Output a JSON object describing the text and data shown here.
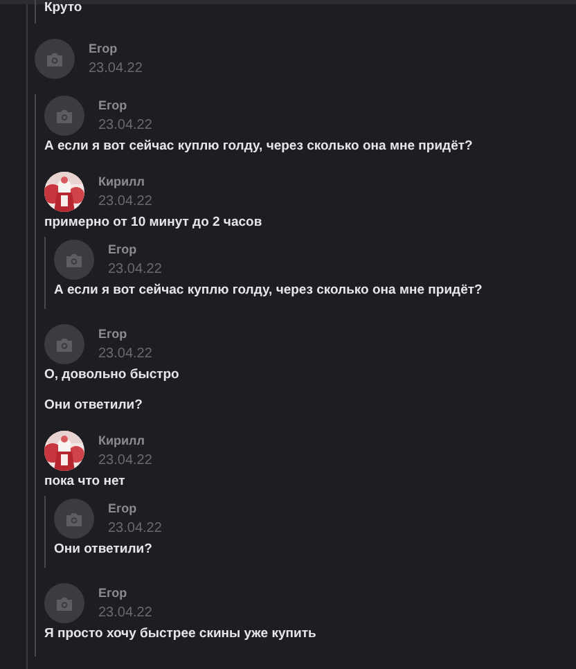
{
  "thread": [
    {
      "kind": "quote",
      "items": [
        {
          "kind": "text",
          "text": "Круто"
        }
      ]
    },
    {
      "kind": "message",
      "author": "Егор",
      "avatar": {
        "kind": "camera"
      },
      "date": "23.04.22"
    },
    {
      "kind": "quote",
      "items": [
        {
          "kind": "message",
          "author": "Егор",
          "avatar": {
            "kind": "camera"
          },
          "date": "23.04.22",
          "texts": [
            "А если я вот сейчас куплю голду, через сколько она мне придёт?"
          ]
        },
        {
          "kind": "message",
          "author": "Кирилл",
          "avatar": {
            "kind": "picture"
          },
          "date": "23.04.22",
          "texts": [
            "примерно от 10 минут до 2 часов"
          ]
        },
        {
          "kind": "quote",
          "items": [
            {
              "kind": "message",
              "author": "Егор",
              "avatar": {
                "kind": "camera"
              },
              "date": "23.04.22",
              "texts": [
                "А если я вот сейчас куплю голду, через сколько она мне придёт?"
              ]
            }
          ]
        },
        {
          "kind": "message",
          "author": "Егор",
          "avatar": {
            "kind": "camera"
          },
          "date": "23.04.22",
          "texts": [
            "О, довольно быстро",
            "Они ответили?"
          ]
        },
        {
          "kind": "message",
          "author": "Кирилл",
          "avatar": {
            "kind": "picture"
          },
          "date": "23.04.22",
          "texts": [
            "пока что нет"
          ]
        },
        {
          "kind": "quote",
          "items": [
            {
              "kind": "message",
              "author": "Егор",
              "avatar": {
                "kind": "camera"
              },
              "date": "23.04.22",
              "texts": [
                "Они ответили?"
              ]
            }
          ]
        },
        {
          "kind": "message",
          "author": "Егор",
          "avatar": {
            "kind": "camera"
          },
          "date": "23.04.22",
          "texts": [
            "Я просто хочу быстрее скины уже купить"
          ]
        }
      ]
    }
  ]
}
